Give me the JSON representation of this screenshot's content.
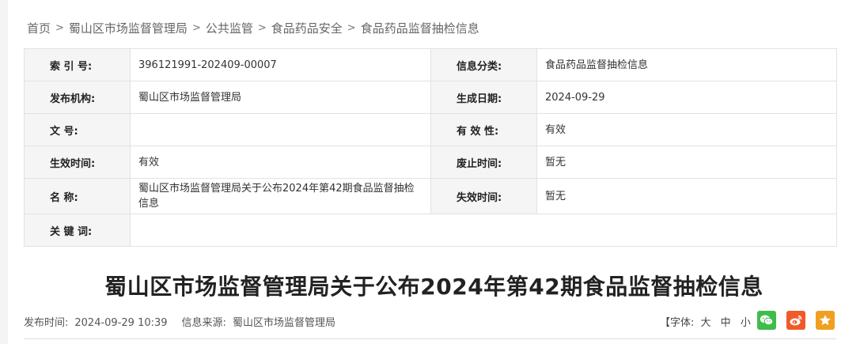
{
  "breadcrumb": {
    "items": [
      "首页",
      "蜀山区市场监督管理局",
      "公共监管",
      "食品药品安全",
      "食品药品监督抽检信息"
    ],
    "separator": ">"
  },
  "meta": {
    "index_label": "索 引 号:",
    "index_value": "396121991-202409-00007",
    "category_label": "信息分类:",
    "category_value": "食品药品监督抽检信息",
    "publisher_label": "发布机构:",
    "publisher_value": "蜀山区市场监督管理局",
    "created_label": "生成日期:",
    "created_value": "2024-09-29",
    "docno_label": "文 号:",
    "docno_value": "",
    "validity_label": "有 效 性:",
    "validity_value": "有效",
    "effective_label": "生效时间:",
    "effective_value": "有效",
    "abolish_label": "废止时间:",
    "abolish_value": "暂无",
    "name_label": "名 称:",
    "name_value": "蜀山区市场监督管理局关于公布2024年第42期食品监督抽检信息",
    "expire_label": "失效时间:",
    "expire_value": "暂无",
    "keywords_label": "关 键 词:",
    "keywords_value": ""
  },
  "article": {
    "title": "蜀山区市场监督管理局关于公布2024年第42期食品监督抽检信息",
    "publish_time_label": "发布时间:",
    "publish_time": "2024-09-29 10:39",
    "source_label": "信息来源:",
    "source": "蜀山区市场监督管理局"
  },
  "font_size": {
    "open": "【字体:",
    "large": "大",
    "medium": "中",
    "small": "小",
    "close": "】"
  },
  "share": {
    "wechat": {
      "icon": "wechat-icon",
      "color": "#3ebd4a"
    },
    "weibo": {
      "icon": "weibo-icon",
      "color": "#f05a2a"
    },
    "favorite": {
      "icon": "star-icon",
      "color": "#f0a020"
    }
  }
}
